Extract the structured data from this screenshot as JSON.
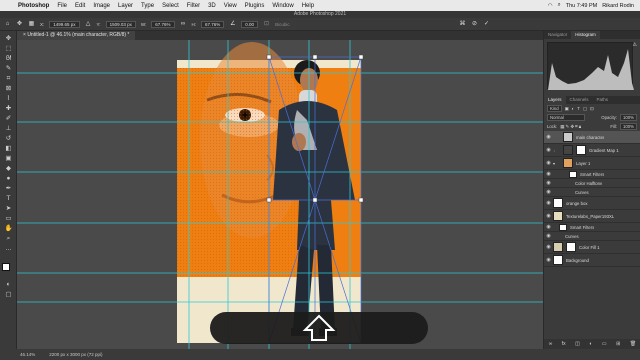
{
  "menubar": {
    "app_name": "Photoshop",
    "items": [
      "File",
      "Edit",
      "Image",
      "Layer",
      "Type",
      "Select",
      "Filter",
      "3D",
      "View",
      "Plugins",
      "Window",
      "Help"
    ],
    "clock": "Thu 7:49 PM",
    "user": "Rikard Rodin"
  },
  "window_title": "Adobe Photoshop 2021",
  "options_bar": {
    "x_label": "X:",
    "x_value": "1499.65 px",
    "y_label": "Y:",
    "y_value": "1509.03 px",
    "w_label": "W:",
    "w_value": "67.76%",
    "h_label": "H:",
    "h_value": "67.76%",
    "angle_value": "0.00",
    "interp_label": "Bicubic"
  },
  "document_tab": "Untitled-1 @ 46.1% (main character, RGB/8) *",
  "status_bar": {
    "zoom": "46.14%",
    "doc_size": "2200 px x 3000 px (72 ppi)"
  },
  "panels": {
    "top_tabs": [
      "Navigator",
      "Histogram"
    ],
    "top_active": "Histogram",
    "layer_tabs": [
      "Layers",
      "Channels",
      "Paths"
    ],
    "layers_active": "Layers",
    "kind_label": "Kind",
    "blend_mode": "Normal",
    "opacity_label": "Opacity:",
    "opacity_value": "100%",
    "lock_label": "Lock:",
    "fill_label": "Fill:",
    "fill_value": "100%",
    "layers": [
      {
        "name": "main character",
        "type": "smart",
        "selected": true
      },
      {
        "name": "Gradient Map 1",
        "type": "adjust"
      },
      {
        "name": "Layer 1",
        "type": "smart"
      },
      {
        "name": "Smart Filters",
        "type": "sub"
      },
      {
        "name": "Color Halftone",
        "type": "sub"
      },
      {
        "name": "Curves",
        "type": "sub"
      },
      {
        "name": "orange box",
        "type": "pixel"
      },
      {
        "name": "Texturelabs_Paper193XL",
        "type": "smart"
      },
      {
        "name": "Smart Filters",
        "type": "sub"
      },
      {
        "name": "Curves",
        "type": "sub"
      },
      {
        "name": "Color Fill 1",
        "type": "fill"
      },
      {
        "name": "Background",
        "type": "bg"
      }
    ]
  },
  "colors": {
    "orange": "#f07f12",
    "paper": "#f1e7cd",
    "guide": "#2ec9d6"
  }
}
